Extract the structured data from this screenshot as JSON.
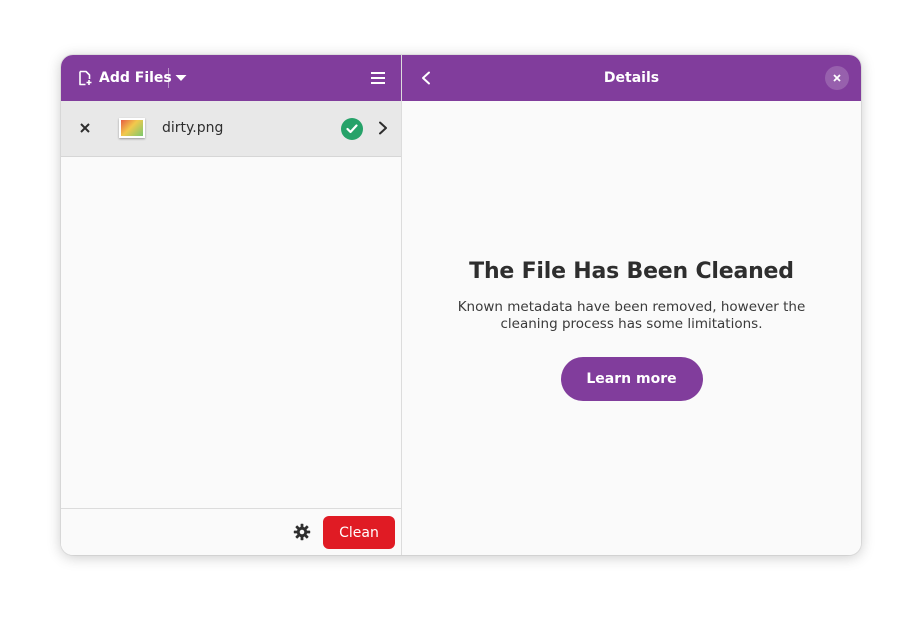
{
  "files_pane": {
    "add_files_label": "Add Files",
    "files": [
      {
        "name": "dirty.png",
        "status": "cleaned"
      }
    ],
    "clean_label": "Clean"
  },
  "details_pane": {
    "title": "Details",
    "status_title": "The File Has Been Cleaned",
    "status_description": "Known metadata have been removed, however the cleaning process has some limitations.",
    "learn_more_label": "Learn more"
  },
  "colors": {
    "accent": "#813d9c",
    "destructive": "#e01b24",
    "success": "#26a269"
  },
  "icons": {
    "add_files": "document-add-icon",
    "dropdown": "chevron-down-icon",
    "menu": "hamburger-menu-icon",
    "back": "chevron-left-icon",
    "close": "close-icon",
    "remove": "close-icon",
    "status": "check-circle-icon",
    "details": "chevron-right-icon",
    "settings": "gear-icon"
  }
}
